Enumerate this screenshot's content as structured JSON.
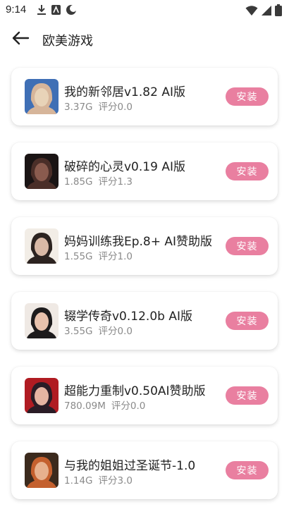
{
  "status_bar": {
    "time": "9:14",
    "left_icons": [
      "download-icon",
      "app-notification-icon",
      "moon-icon"
    ],
    "right_icons": [
      "wifi-icon",
      "signal-icon",
      "battery-icon"
    ]
  },
  "header": {
    "back_icon": "arrow-left-icon",
    "title": "欧美游戏"
  },
  "colors": {
    "install_button": "#e97fa0",
    "title_text": "#222222",
    "meta_text": "#8a8a8a"
  },
  "games": [
    {
      "title": "我的新邻居v1.82 AI版",
      "size": "3.37G",
      "rating": "评分0.0",
      "button": "安装",
      "thumb_colors": [
        "#3f6fb5",
        "#d6b59a",
        "#e8d3b8"
      ]
    },
    {
      "title": "破碎的心灵v0.19 AI版",
      "size": "1.85G",
      "rating": "评分1.3",
      "button": "安装",
      "thumb_colors": [
        "#1a1414",
        "#4a2e28",
        "#8a5b4e"
      ]
    },
    {
      "title": "妈妈训练我Ep.8+ AI赞助版",
      "size": "1.55G",
      "rating": "评分1.0",
      "button": "安装",
      "thumb_colors": [
        "#f2ede6",
        "#2c2320",
        "#d9b9a6"
      ]
    },
    {
      "title": "辍学传奇v0.12.0b AI版",
      "size": "3.55G",
      "rating": "评分0.0",
      "button": "安装",
      "thumb_colors": [
        "#efe9e4",
        "#1d1b1c",
        "#e8c2ad"
      ]
    },
    {
      "title": "超能力重制v0.50AI赞助版",
      "size": "780.09M",
      "rating": "评分0.0",
      "button": "安装",
      "thumb_colors": [
        "#b01b22",
        "#2a1c26",
        "#e5b4a2"
      ]
    },
    {
      "title": "与我的姐姐过圣诞节-1.0",
      "size": "1.14G",
      "rating": "评分3.0",
      "button": "安装",
      "thumb_colors": [
        "#3b2a1d",
        "#c4602e",
        "#e7b18e"
      ]
    }
  ]
}
